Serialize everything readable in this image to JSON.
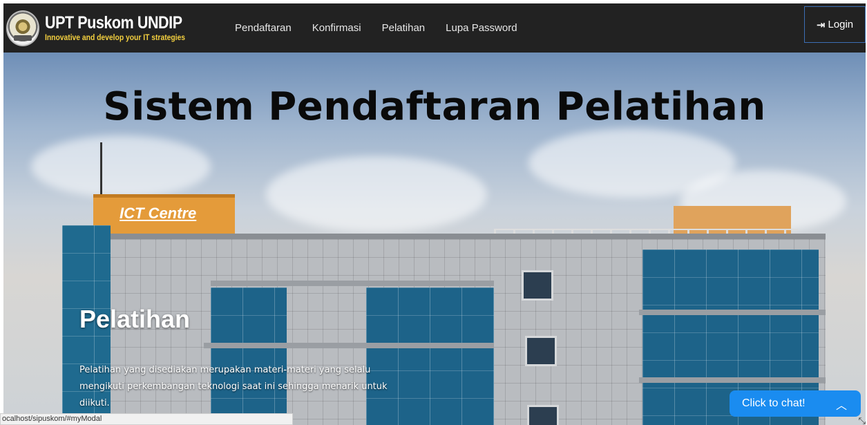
{
  "brand": {
    "title": "UPT Puskom UNDIP",
    "subtitle": "Innovative and develop your IT strategies",
    "logo_icon": "undip-seal-icon"
  },
  "nav": {
    "items": [
      {
        "label": "Pendaftaran"
      },
      {
        "label": "Konfirmasi"
      },
      {
        "label": "Pelatihan"
      },
      {
        "label": "Lupa Password"
      }
    ],
    "login_label": "Login",
    "login_icon": "sign-in-icon"
  },
  "hero": {
    "title": "Sistem Pendaftaran Pelatihan",
    "building_sign": "ICT Centre",
    "caption_title": "Pelatihan",
    "caption_text": "Pelatihan yang disediakan merupakan materi-materi yang selalu mengikuti perkembangan teknologi saat ini sehingga menarik untuk diikuti."
  },
  "status_bar": {
    "url": "ocalhost/sipuskom/#myModal"
  },
  "chat": {
    "label": "Click to chat!",
    "chevron_icon": "chevron-up-icon"
  },
  "colors": {
    "navbar": "#222222",
    "brand_subtitle": "#f4d03f",
    "login_border": "#3c6fb5",
    "chat_button": "#1a8cf0"
  }
}
